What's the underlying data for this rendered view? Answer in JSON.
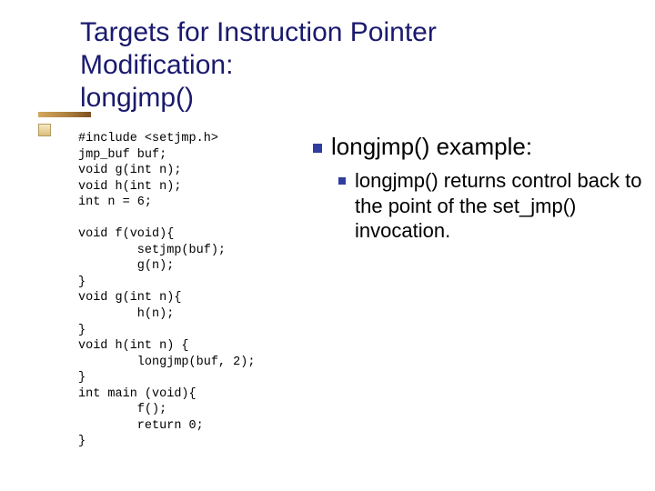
{
  "title": "Targets for Instruction Pointer\nModification:\nlongjmp()",
  "code": "#include <setjmp.h>\njmp_buf buf;\nvoid g(int n);\nvoid h(int n);\nint n = 6;\n\nvoid f(void){\n        setjmp(buf);\n        g(n);\n}\nvoid g(int n){\n        h(n);\n}\nvoid h(int n) {\n        longjmp(buf, 2);\n}\nint main (void){\n        f();\n        return 0;\n}",
  "bullet1": "longjmp() example:",
  "bullet2": "longjmp() returns control back to the point of the set_jmp() invocation."
}
